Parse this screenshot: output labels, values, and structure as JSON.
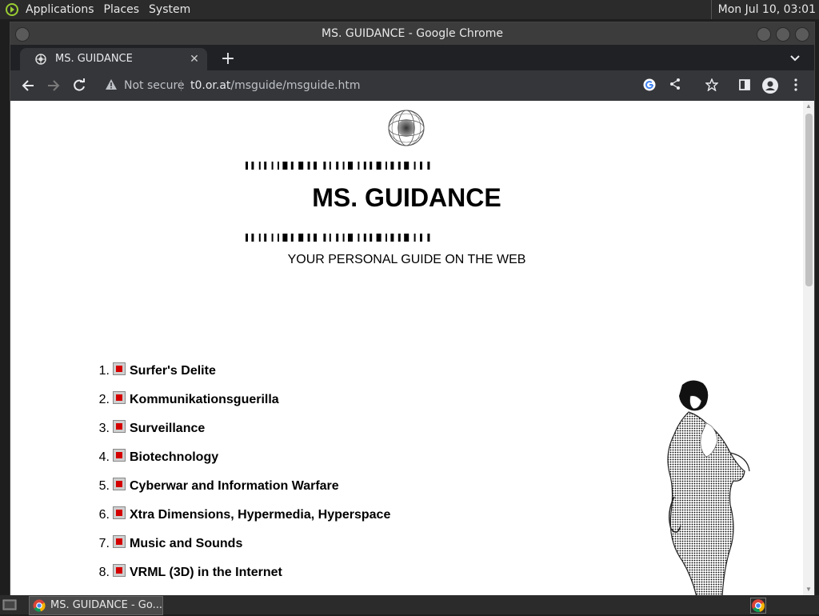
{
  "desktop": {
    "menus": [
      "Applications",
      "Places",
      "System"
    ],
    "clock": "Mon Jul 10, 03:01"
  },
  "window": {
    "title": "MS. GUIDANCE - Google Chrome"
  },
  "tab": {
    "title": "MS. GUIDANCE",
    "close": "✕",
    "new_tab": "+"
  },
  "omnibox": {
    "security": "Not secure",
    "host": "t0.or.at",
    "path": "/msguide/msguide.htm"
  },
  "page": {
    "heading": "MS. GUIDANCE",
    "tagline": "YOUR PERSONAL GUIDE ON THE WEB",
    "topics": [
      {
        "num": "1.",
        "label": "Surfer's Delite"
      },
      {
        "num": "2.",
        "label": "Kommunikationsguerilla"
      },
      {
        "num": "3.",
        "label": "Surveillance"
      },
      {
        "num": "4.",
        "label": "Biotechnology"
      },
      {
        "num": "5.",
        "label": "Cyberwar and Information Warfare"
      },
      {
        "num": "6.",
        "label": "Xtra Dimensions, Hypermedia, Hyperspace"
      },
      {
        "num": "7.",
        "label": "Music and Sounds"
      },
      {
        "num": "8.",
        "label": "VRML (3D) in the Internet"
      }
    ]
  },
  "taskbar": {
    "window_label": "MS. GUIDANCE - Go..."
  },
  "colors": {
    "bullet_red": "#d40000",
    "chrome_toolbar": "#35363a",
    "panel": "#2b2b2b"
  }
}
